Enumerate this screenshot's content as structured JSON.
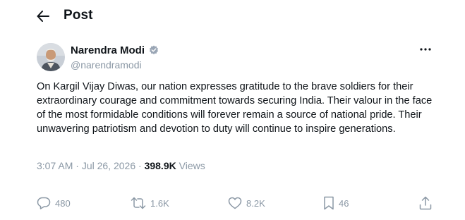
{
  "header": {
    "title": "Post"
  },
  "author": {
    "name": "Narendra Modi",
    "handle": "@narendramodi"
  },
  "tweet": {
    "text": "On Kargil Vijay Diwas, our nation expresses gratitude to the brave soldiers for their extraordinary courage and commitment towards securing India. Their valour in the face of the most formidable conditions will forever remain a source of national pride. Their unwavering patriotism and devotion to duty will continue to inspire generations."
  },
  "meta": {
    "time": "3:07 AM",
    "separator": " · ",
    "date": "Jul 26, 2026",
    "views_count": "398.9K",
    "views_label": "Views"
  },
  "actions": {
    "replies": "480",
    "reposts": "1.6K",
    "likes": "8.2K",
    "bookmarks": "46"
  },
  "icons": {
    "back": "arrow-left-icon",
    "verified": "verified-badge-icon",
    "more": "more-horizontal-icon",
    "reply": "reply-icon",
    "repost": "repost-icon",
    "like": "heart-icon",
    "bookmark": "bookmark-icon",
    "share": "share-icon"
  },
  "colors": {
    "text_primary": "#0f1419",
    "text_secondary": "#8b98a5",
    "verified": "#9aa6b5"
  }
}
